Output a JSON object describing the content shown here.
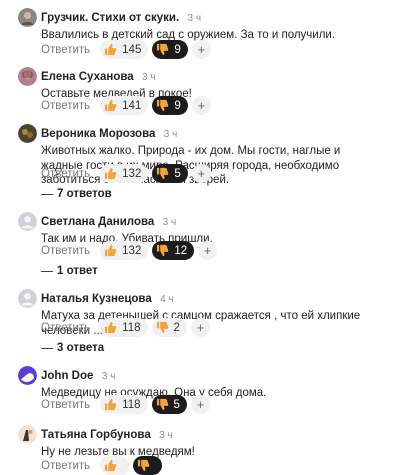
{
  "ui": {
    "reply_label": "Ответить",
    "more_symbol": "+"
  },
  "comments": [
    {
      "author": "Грузчик. Стихи от скуки.",
      "time": "3 ч",
      "text": "Ввалились в детский сад с оружием. За то и получили.",
      "likes": "145",
      "dislikes": "9",
      "dislike_active": true,
      "replies_label": ""
    },
    {
      "author": "Елена Суханова",
      "time": "3 ч",
      "text": "Оставьте медведей в покое!",
      "likes": "141",
      "dislikes": "9",
      "dislike_active": true,
      "replies_label": ""
    },
    {
      "author": "Вероника Морозова",
      "time": "3 ч",
      "text": "Животных жалко. Природа - их дом. Мы гости, наглые и жадные гости в их мире. Расширяя города, необходимо заботиться о безопасности зверей.",
      "likes": "132",
      "dislikes": "5",
      "dislike_active": true,
      "replies_label": "7 ответов"
    },
    {
      "author": "Светлана Данилова",
      "time": "3 ч",
      "text": "Так им и надо. Убивать пришли.",
      "likes": "132",
      "dislikes": "12",
      "dislike_active": true,
      "replies_label": "1 ответ"
    },
    {
      "author": "Наталья Кузнецова",
      "time": "4 ч",
      "text": "Матуха за детенышей с самцом сражается , что ей хлипкие человеки ...",
      "likes": "118",
      "dislikes": "2",
      "dislike_active": false,
      "replies_label": "3 ответа"
    },
    {
      "author": "John Doe",
      "time": "3 ч",
      "text": "Медведицу не осуждаю. Она у себя дома.",
      "likes": "118",
      "dislikes": "5",
      "dislike_active": true,
      "replies_label": ""
    },
    {
      "author": "Татьяна Горбунова",
      "time": "3 ч",
      "text": "Ну не лезьте вы к медведям!",
      "likes": "",
      "dislikes": "",
      "dislike_active": true,
      "replies_label": ""
    }
  ],
  "avatars": [
    "#9a8f88",
    "#b07a8a",
    "#6b5a3a",
    "#c9ced6",
    "#c9ced6",
    "#5b3fd0",
    "#e8d9c4"
  ],
  "colors": {
    "like_thumb": "#f2a33a",
    "dislike_thumb": "#f2a33a",
    "dislike_active_bg": "#1c1c1c"
  }
}
